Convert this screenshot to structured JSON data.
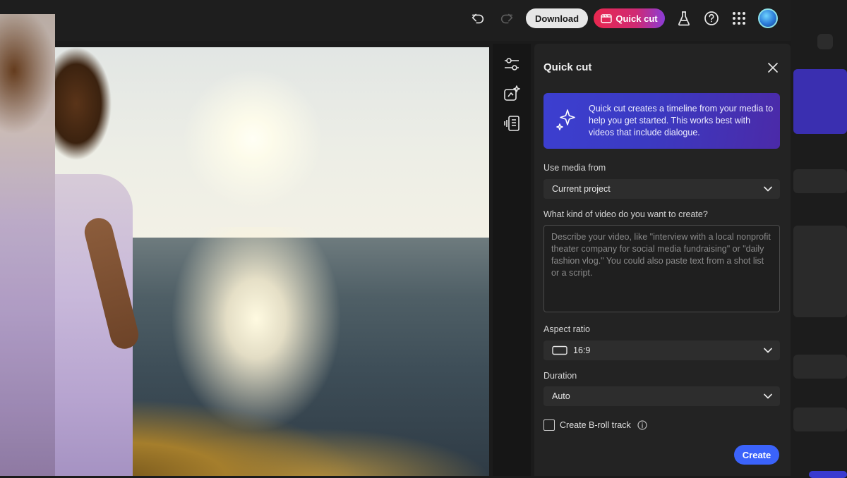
{
  "toolbar": {
    "download_label": "Download",
    "quick_cut_label": "Quick cut"
  },
  "panel": {
    "title": "Quick cut",
    "info_text": "Quick cut creates a timeline from your media to help you get started. This works best with videos that include dialogue.",
    "media_label": "Use media from",
    "media_value": "Current project",
    "video_kind_label": "What kind of video do you want to create?",
    "video_kind_placeholder": "Describe your video, like \"interview with a local nonprofit theater company for social media fundraising\" or \"daily fashion vlog.\" You could also paste text from a shot list or a script.",
    "aspect_label": "Aspect ratio",
    "aspect_value": "16:9",
    "duration_label": "Duration",
    "duration_value": "Auto",
    "broll_label": "Create B-roll track",
    "create_label": "Create"
  },
  "colors": {
    "accent_blue": "#3b63fb",
    "quick_cut_red": "#e8284f",
    "info_card": "#3c3fd0",
    "panel_bg": "#232323"
  }
}
